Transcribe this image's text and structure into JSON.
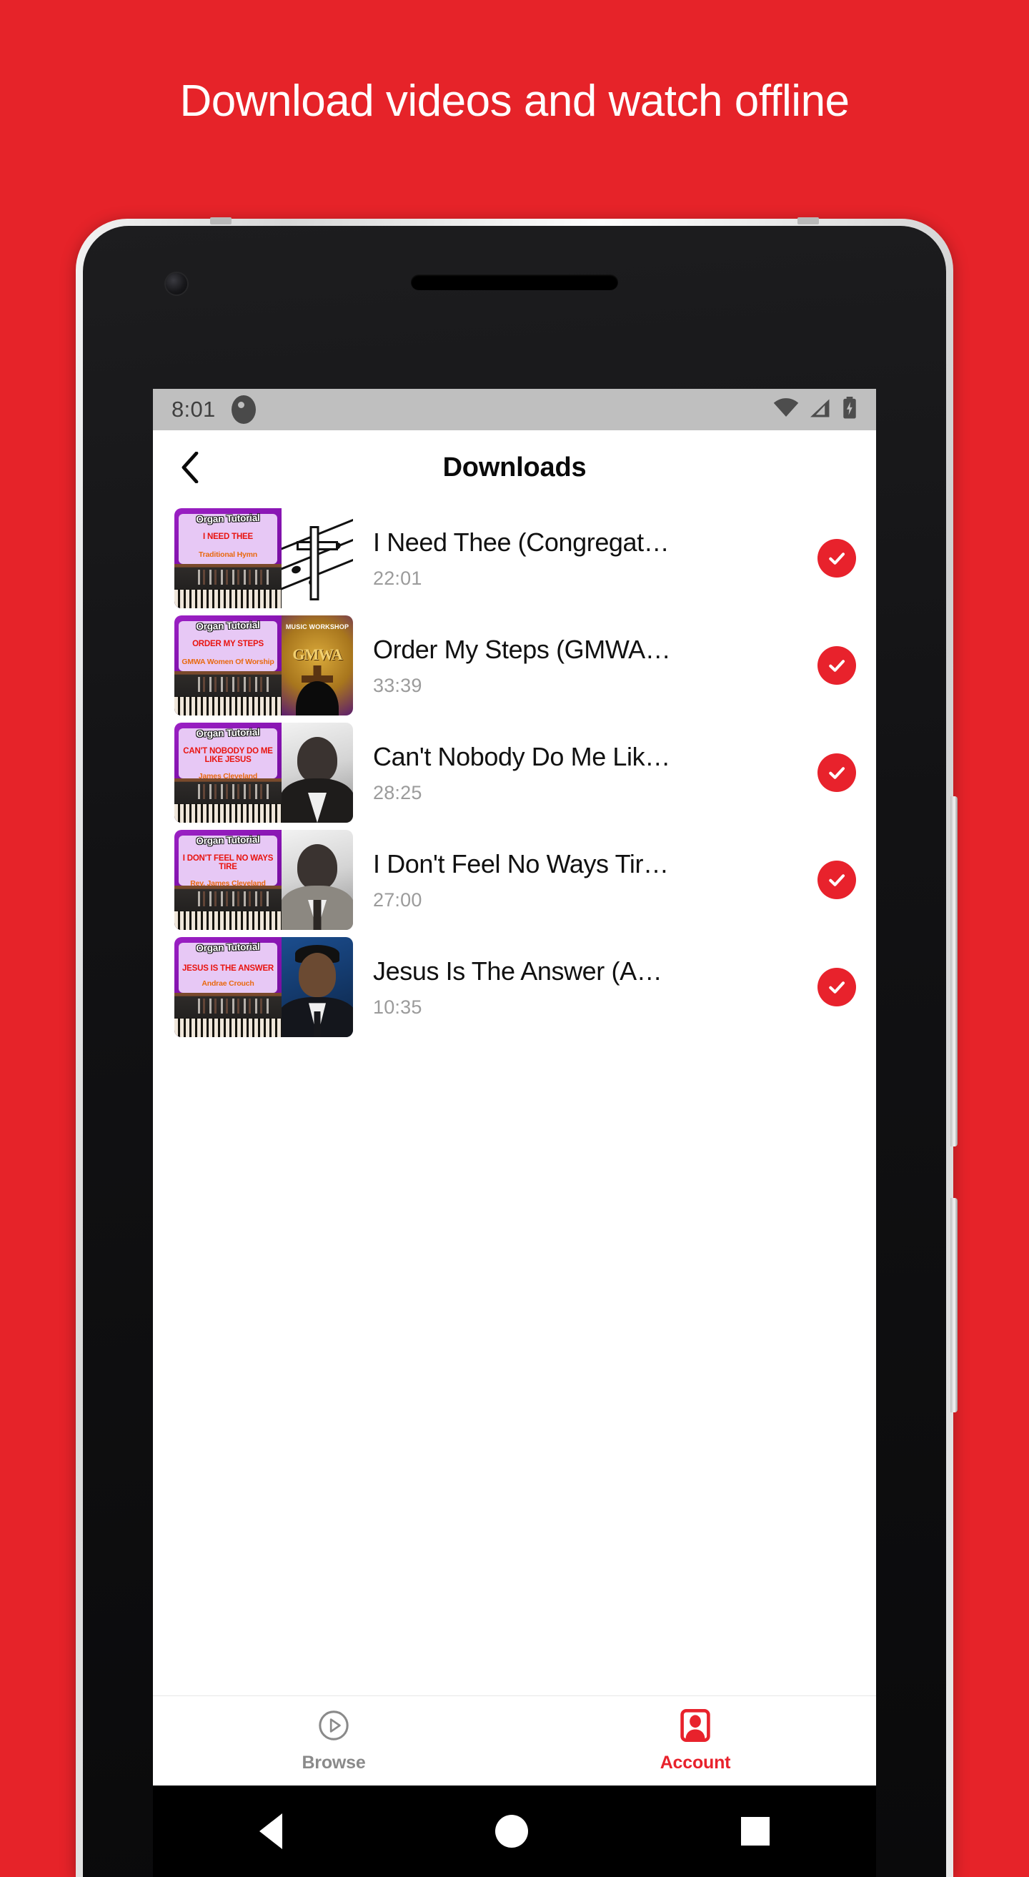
{
  "promo": {
    "headline": "Download videos and watch offline",
    "background_color": "#E62329"
  },
  "status_bar": {
    "time": "8:01",
    "app_icon": "notification-app-icon",
    "icons": [
      "wifi-icon",
      "cellular-signal-icon",
      "battery-charging-icon"
    ]
  },
  "app_bar": {
    "back_label": "‹",
    "title": "Downloads"
  },
  "downloads": [
    {
      "title": "I Need Thee (Congregat…",
      "duration": "22:01",
      "status": "downloaded",
      "thumbnail": {
        "tutorial_label": "Organ Tutorial",
        "song_title": "I NEED THEE",
        "artist": "Traditional Hymn",
        "artwork": "cross-and-music-notes"
      }
    },
    {
      "title": "Order My Steps (GMWA…",
      "duration": "33:39",
      "status": "downloaded",
      "thumbnail": {
        "tutorial_label": "Organ Tutorial",
        "song_title": "ORDER MY STEPS",
        "artist": "GMWA Women Of Worship",
        "artwork": "gmwa-music-workshop-logo",
        "artwork_text_top": "MUSIC WORKSHOP",
        "artwork_text_main": "GMWA"
      }
    },
    {
      "title": "Can't Nobody Do Me Lik…",
      "duration": "28:25",
      "status": "downloaded",
      "thumbnail": {
        "tutorial_label": "Organ Tutorial",
        "song_title": "CAN'T NOBODY DO ME LIKE JESUS",
        "artist": "James Cleveland",
        "artwork": "portrait-black-and-white"
      }
    },
    {
      "title": "I Don't Feel No Ways Tir…",
      "duration": "27:00",
      "status": "downloaded",
      "thumbnail": {
        "tutorial_label": "Organ Tutorial",
        "song_title": "I DON'T FEEL NO WAYS TIRE",
        "artist": "Rev. James Cleveland",
        "artwork": "portrait-gray-suit"
      }
    },
    {
      "title": "Jesus Is The Answer (A…",
      "duration": "10:35",
      "status": "downloaded",
      "thumbnail": {
        "tutorial_label": "Organ Tutorial",
        "song_title": "JESUS IS THE ANSWER",
        "artist": "Andrae Crouch",
        "artwork": "portrait-blue-stage"
      }
    }
  ],
  "tab_bar": {
    "items": [
      {
        "label": "Browse",
        "icon": "play-circle-icon",
        "active": false
      },
      {
        "label": "Account",
        "icon": "account-person-icon",
        "active": true
      }
    ]
  },
  "android_nav": {
    "back": "back-triangle-icon",
    "home": "home-circle-icon",
    "recents": "recents-square-icon"
  },
  "colors": {
    "brand_red": "#E8222C",
    "promo_red": "#E62329",
    "muted_gray": "#9b9b9b"
  }
}
